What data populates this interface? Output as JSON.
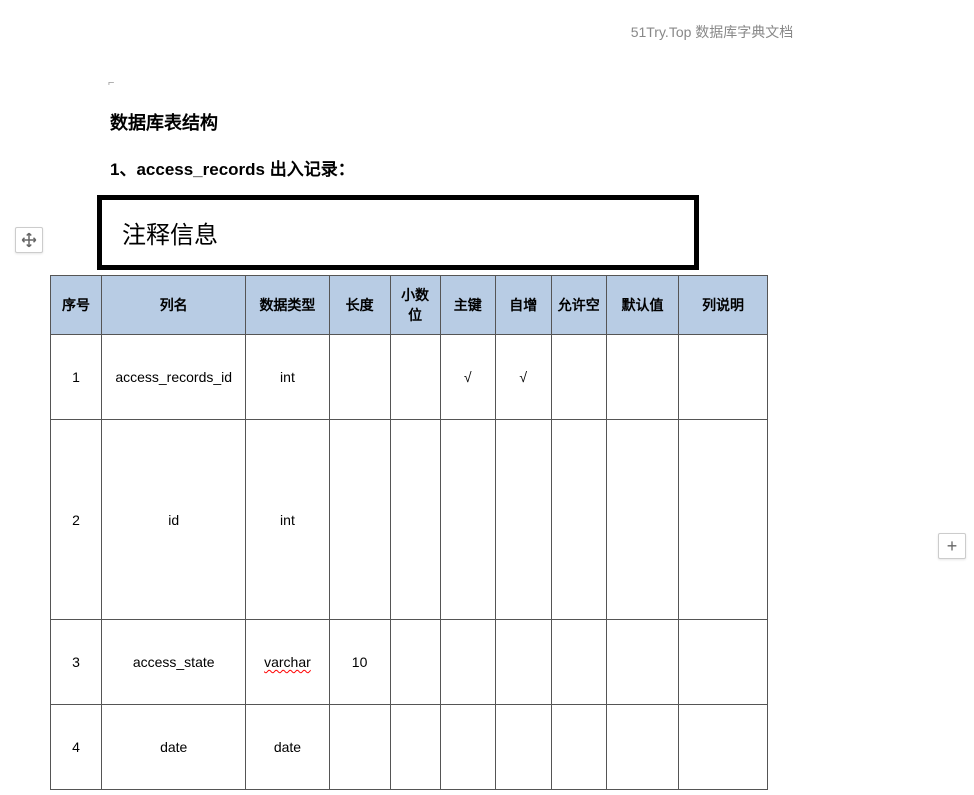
{
  "header_text": "51Try.Top 数据库字典文档",
  "title_main": "数据库表结构",
  "subtitle": "1、access_records 出入记录：",
  "comment_label": "注释信息",
  "table": {
    "headers": {
      "seq": "序号",
      "name": "列名",
      "type": "数据类型",
      "len": "长度",
      "dec": "小数位",
      "pk": "主键",
      "ai": "自增",
      "nullable": "允许空",
      "default": "默认值",
      "desc": "列说明"
    },
    "rows": [
      {
        "seq": "1",
        "name": "access_records_id",
        "type": "int",
        "len": "",
        "dec": "",
        "pk": "√",
        "ai": "√",
        "nullable": "",
        "default": "",
        "desc": ""
      },
      {
        "seq": "2",
        "name": "id",
        "type": "int",
        "len": "",
        "dec": "",
        "pk": "",
        "ai": "",
        "nullable": "",
        "default": "",
        "desc": ""
      },
      {
        "seq": "3",
        "name": "access_state",
        "type": "varchar",
        "len": "10",
        "dec": "",
        "pk": "",
        "ai": "",
        "nullable": "",
        "default": "",
        "desc": ""
      },
      {
        "seq": "4",
        "name": "date",
        "type": "date",
        "len": "",
        "dec": "",
        "pk": "",
        "ai": "",
        "nullable": "",
        "default": "",
        "desc": ""
      }
    ]
  }
}
